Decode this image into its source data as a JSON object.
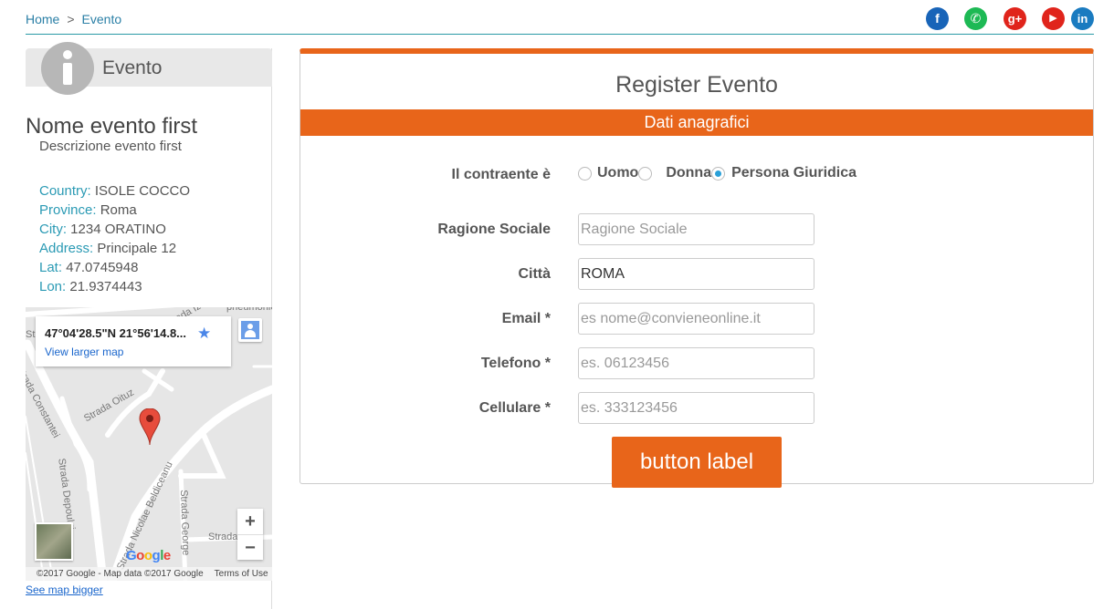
{
  "breadcrumb": {
    "home": "Home",
    "separator": ">",
    "current": "Evento"
  },
  "social": [
    {
      "icon": "facebook-icon",
      "glyph": "f",
      "color": "#1864b8"
    },
    {
      "icon": "whatsapp-icon",
      "glyph": "✆",
      "color": "#1db954"
    },
    {
      "icon": "google-plus-icon",
      "glyph": "g+",
      "color": "#e0241b"
    },
    {
      "icon": "youtube-icon",
      "glyph": "▶",
      "color": "#e0241b"
    },
    {
      "icon": "linkedin-icon",
      "glyph": "in",
      "color": "#1a7bc0"
    }
  ],
  "sidebar": {
    "title": "Evento",
    "event_name": "Nome evento first",
    "event_description": "Descrizione evento first",
    "details": [
      {
        "key": "Country:",
        "value": "ISOLE COCCO"
      },
      {
        "key": "Province:",
        "value": "Roma"
      },
      {
        "key": "City:",
        "value": "1234 ORATINO"
      },
      {
        "key": "Address:",
        "value": "Principale 12"
      },
      {
        "key": "Lat:",
        "value": "47.0745948"
      },
      {
        "key": "Lon:",
        "value": "21.9374443"
      }
    ],
    "map": {
      "coords": "47°04'28.5\"N 21°56'14.8...",
      "view_larger": "View larger map",
      "zoom_in": "+",
      "zoom_out": "−",
      "footer": "©2017 Google - Map data ©2017 Google",
      "terms": "Terms of Use",
      "roads": [
        "Strada Constantei",
        "Strada Oituz",
        "Strada Depoului",
        "Strada Nicolae Beldiceanu",
        "Strada George",
        "Strada",
        "pneumoniei",
        "Strada Izvo",
        "Strada"
      ]
    },
    "see_bigger": "See map bigger"
  },
  "form": {
    "title": "Register Evento",
    "section": "Dati anagrafici",
    "contraente_label": "Il contraente è",
    "radio_options": [
      {
        "label": "Uomo",
        "checked": false
      },
      {
        "label": "Donna",
        "checked": false
      },
      {
        "label": "Persona Giuridica",
        "checked": true
      }
    ],
    "fields": {
      "ragione": {
        "label": "Ragione Sociale",
        "value": "",
        "placeholder": "Ragione Sociale"
      },
      "citta": {
        "label": "Città",
        "value": "ROMA",
        "placeholder": ""
      },
      "email": {
        "label": "Email *",
        "value": "",
        "placeholder": "es nome@convieneonline.it"
      },
      "telefono": {
        "label": "Telefono *",
        "value": "",
        "placeholder": "es. 06123456"
      },
      "cellulare": {
        "label": "Cellulare *",
        "value": "",
        "placeholder": "es. 333123456"
      }
    },
    "submit_label": "button label"
  },
  "colors": {
    "accent": "#e8651a",
    "link": "#2a9ab4",
    "checked_radio": "#2aa0d8"
  }
}
